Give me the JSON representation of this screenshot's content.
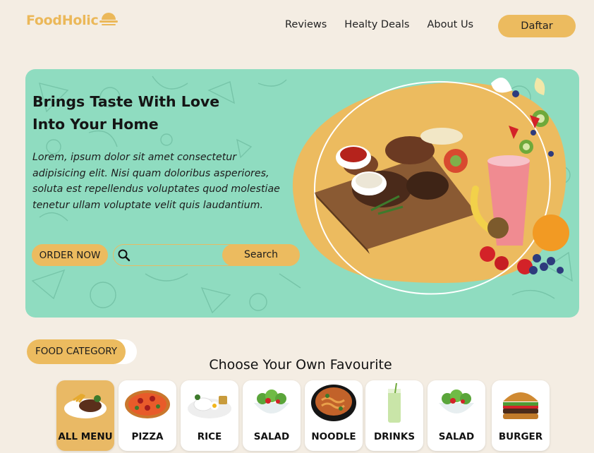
{
  "brand": {
    "name": "FoodHolic",
    "logo_icon": "cloche-icon",
    "accent": "#ecbb5f",
    "hero_bg": "#8fdcc0"
  },
  "nav": {
    "items": [
      "Reviews",
      "Healty Deals",
      "About Us"
    ],
    "cta": "Daftar"
  },
  "hero": {
    "title_line1": "Brings Taste With Love",
    "title_line2": "Into Your Home",
    "description": "Lorem, ipsum dolor sit amet consectetur adipisicing elit. Nisi quam doloribus asperiores, soluta est repellendus voluptates quod molestiae tenetur ullam voluptate velit quis laudantium.",
    "order_button": "ORDER NOW",
    "search_placeholder": "",
    "search_button": "Search"
  },
  "category": {
    "pill": "FOOD CATEGORY",
    "heading": "Choose Your Own Favourite",
    "items": [
      {
        "label": "ALL MENU",
        "icon": "steak-plate-icon",
        "active": true
      },
      {
        "label": "PIZZA",
        "icon": "pizza-icon",
        "active": false
      },
      {
        "label": "RICE",
        "icon": "rice-plate-icon",
        "active": false
      },
      {
        "label": "SALAD",
        "icon": "salad-bowl-icon",
        "active": false
      },
      {
        "label": "NOODLE",
        "icon": "noodle-bowl-icon",
        "active": false
      },
      {
        "label": "DRINKS",
        "icon": "drink-glass-icon",
        "active": false
      },
      {
        "label": "SALAD",
        "icon": "salad-bowl-icon",
        "active": false
      },
      {
        "label": "BURGER",
        "icon": "burger-icon",
        "active": false
      }
    ]
  }
}
